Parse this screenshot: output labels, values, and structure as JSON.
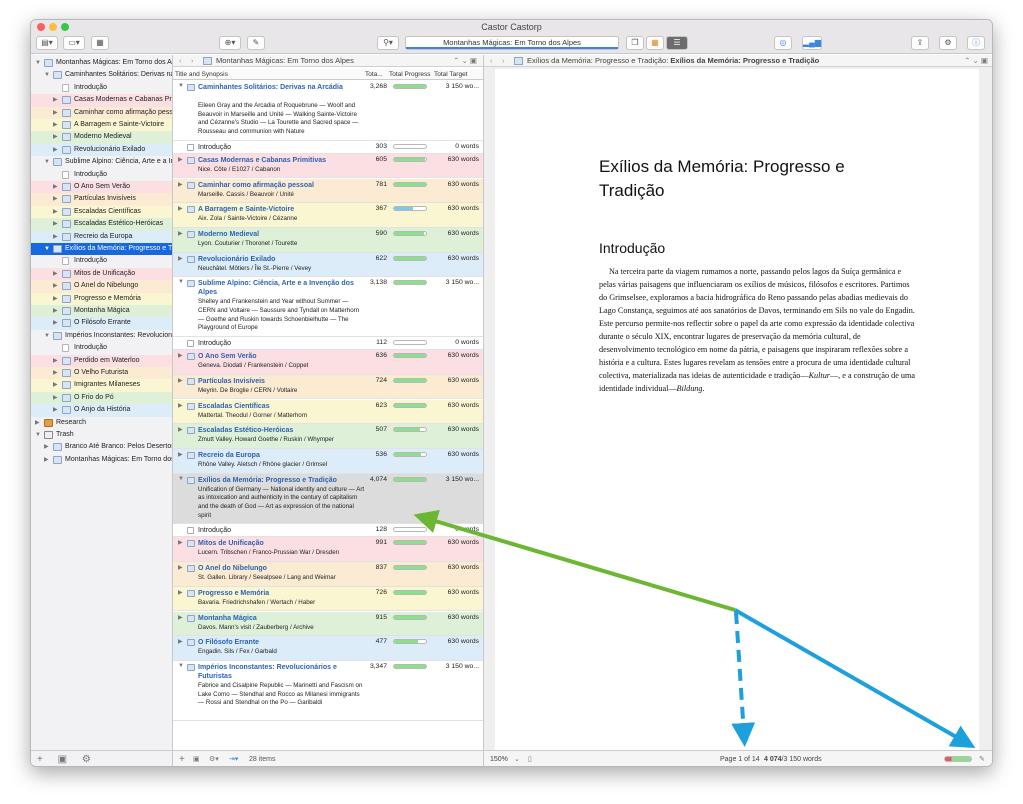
{
  "window": {
    "title": "Castor Castorp"
  },
  "toolbar": {
    "breadcrumb": "Montanhas Mágicas: Em Torno dos Alpes"
  },
  "binder": {
    "items": [
      {
        "label": "Montanhas Mágicas: Em Torno dos Alpes",
        "level": 0,
        "type": "folder",
        "tri": "▼"
      },
      {
        "label": "Caminhantes Solitários: Derivas na Arcádia",
        "level": 1,
        "type": "folder",
        "tri": "▼"
      },
      {
        "label": "Introdução",
        "level": 2,
        "type": "doc",
        "tri": ""
      },
      {
        "label": "Casas Modernas e Cabanas Primitivas",
        "level": 2,
        "type": "folder",
        "tri": "▶",
        "color": "pink"
      },
      {
        "label": "Caminhar como afirmação pessoal",
        "level": 2,
        "type": "folder",
        "tri": "▶",
        "color": "orange"
      },
      {
        "label": "A Barragem e Sainte-Victoire",
        "level": 2,
        "type": "folder",
        "tri": "▶",
        "color": "yellow"
      },
      {
        "label": "Moderno Medieval",
        "level": 2,
        "type": "folder",
        "tri": "▶",
        "color": "green"
      },
      {
        "label": "Revolucionário Exilado",
        "level": 2,
        "type": "folder",
        "tri": "▶",
        "color": "blue"
      },
      {
        "label": "Sublime Alpino: Ciência, Arte e a Invenção dos Alpes",
        "level": 1,
        "type": "folder",
        "tri": "▼"
      },
      {
        "label": "Introdução",
        "level": 2,
        "type": "doc",
        "tri": ""
      },
      {
        "label": "O Ano Sem Verão",
        "level": 2,
        "type": "folder",
        "tri": "▶",
        "color": "pink"
      },
      {
        "label": "Partículas Invisíveis",
        "level": 2,
        "type": "folder",
        "tri": "▶",
        "color": "orange"
      },
      {
        "label": "Escaladas Científicas",
        "level": 2,
        "type": "folder",
        "tri": "▶",
        "color": "yellow"
      },
      {
        "label": "Escaladas Estético-Heróicas",
        "level": 2,
        "type": "folder",
        "tri": "▶",
        "color": "green"
      },
      {
        "label": "Recreio da Europa",
        "level": 2,
        "type": "folder",
        "tri": "▶",
        "color": "blue"
      },
      {
        "label": "Exílios da Memória: Progresso e Tradição",
        "level": 1,
        "type": "folder",
        "tri": "▼",
        "selected": true
      },
      {
        "label": "Introdução",
        "level": 2,
        "type": "doc",
        "tri": ""
      },
      {
        "label": "Mitos de Unificação",
        "level": 2,
        "type": "folder",
        "tri": "▶",
        "color": "pink"
      },
      {
        "label": "O Anel do Nibelungo",
        "level": 2,
        "type": "folder",
        "tri": "▶",
        "color": "orange"
      },
      {
        "label": "Progresso e Memória",
        "level": 2,
        "type": "folder",
        "tri": "▶",
        "color": "yellow"
      },
      {
        "label": "Montanha Mágica",
        "level": 2,
        "type": "folder",
        "tri": "▶",
        "color": "green"
      },
      {
        "label": "O Filósofo Errante",
        "level": 2,
        "type": "folder",
        "tri": "▶",
        "color": "blue"
      },
      {
        "label": "Impérios Inconstantes: Revolucionários e Futuristas",
        "level": 1,
        "type": "folder",
        "tri": "▼"
      },
      {
        "label": "Introdução",
        "level": 2,
        "type": "doc",
        "tri": ""
      },
      {
        "label": "Perdido em Waterloo",
        "level": 2,
        "type": "folder",
        "tri": "▶",
        "color": "pink"
      },
      {
        "label": "O Velho Futurista",
        "level": 2,
        "type": "folder",
        "tri": "▶",
        "color": "orange"
      },
      {
        "label": "Imigrantes Milaneses",
        "level": 2,
        "type": "folder",
        "tri": "▶",
        "color": "yellow"
      },
      {
        "label": "O Frio do Pó",
        "level": 2,
        "type": "folder",
        "tri": "▶",
        "color": "green"
      },
      {
        "label": "O Anjo da História",
        "level": 2,
        "type": "folder",
        "tri": "▶",
        "color": "blue"
      },
      {
        "label": "Research",
        "level": 0,
        "type": "research",
        "tri": "▶"
      },
      {
        "label": "Trash",
        "level": 0,
        "type": "trash",
        "tri": "▼"
      },
      {
        "label": "Branco Até Branco: Pelos Desertos do Oriente",
        "level": 1,
        "type": "folder",
        "tri": "▶"
      },
      {
        "label": "Montanhas Mágicas: Em Torno dos Alpes",
        "level": 1,
        "type": "folder",
        "tri": "▶"
      }
    ]
  },
  "outliner": {
    "header": "Montanhas Mágicas: Em Torno dos Alpes",
    "columns": {
      "title": "Title and Synopsis",
      "total": "Tota...",
      "progress": "Total Progress",
      "target": "Total Target"
    },
    "rows": [
      {
        "title": "Caminhantes Solitários: Derivas na Arcádia",
        "synopsis": "Eileen Gray and the Arcadia of Roquebrune — Woolf and Beauvoir in Marseille and Unité — Walking Sainte-Victoire and Cézanne's Studio — La Tourette and Sacred space — Rousseau and communion with Nature",
        "total": "3,268",
        "progress": 1.0,
        "target": "3 150 wo...",
        "tri": "▼",
        "type": "folder"
      },
      {
        "title": "Introdução",
        "synopsis": "",
        "total": "303",
        "progress": 0,
        "target": "0 words",
        "tri": "",
        "type": "doc",
        "plain": true
      },
      {
        "title": "Casas Modernas e Cabanas Primitivas",
        "synopsis": "Nice. Côte / E1027 / Cabanon",
        "total": "605",
        "progress": 0.96,
        "target": "630 words",
        "tri": "▶",
        "type": "folder",
        "color": "pink"
      },
      {
        "title": "Caminhar como afirmação pessoal",
        "synopsis": "Marseille. Cassis / Beauvoir / Unité",
        "total": "781",
        "progress": 1.0,
        "target": "630 words",
        "tri": "▶",
        "type": "folder",
        "color": "orange"
      },
      {
        "title": "A Barragem e Sainte-Victoire",
        "synopsis": "Aix. Zola / Sainte-Victoire / Cézanne",
        "total": "367",
        "progress": 0.58,
        "target": "630 words",
        "tri": "▶",
        "type": "folder",
        "color": "yellow"
      },
      {
        "title": "Moderno Medieval",
        "synopsis": "Lyon. Couturier / Thoronet / Tourette",
        "total": "590",
        "progress": 0.94,
        "target": "630 words",
        "tri": "▶",
        "type": "folder",
        "color": "green"
      },
      {
        "title": "Revolucionário Exilado",
        "synopsis": "Neuchâtel. Môtiers / Île St.-Pierre / Vevey",
        "total": "622",
        "progress": 0.99,
        "target": "630 words",
        "tri": "▶",
        "type": "folder",
        "color": "blue"
      },
      {
        "title": "Sublime Alpino: Ciência, Arte e a Invenção dos Alpes",
        "synopsis": "Shelley and Frankenstein and Year without Summer — CERN and Voltaire — Saussure and Tyndall on Matterhorn — Goethe and Ruskin towards Schoenbielhutte — The Playground of Europe",
        "total": "3,138",
        "progress": 1.0,
        "target": "3 150 wo...",
        "tri": "▼",
        "type": "folder"
      },
      {
        "title": "Introdução",
        "synopsis": "",
        "total": "112",
        "progress": 0,
        "target": "0 words",
        "tri": "",
        "type": "doc",
        "plain": true
      },
      {
        "title": "O Ano Sem Verão",
        "synopsis": "Geneva. Diodati / Frankenstein / Coppet",
        "total": "636",
        "progress": 1.0,
        "target": "630 words",
        "tri": "▶",
        "type": "folder",
        "color": "pink"
      },
      {
        "title": "Partículas Invisíveis",
        "synopsis": "Meyrin. De Broglie / CERN / Voltaire",
        "total": "724",
        "progress": 1.0,
        "target": "630 words",
        "tri": "▶",
        "type": "folder",
        "color": "orange"
      },
      {
        "title": "Escaladas Científicas",
        "synopsis": "Mattertal. Theodul / Gorner / Matterhorn",
        "total": "623",
        "progress": 0.99,
        "target": "630 words",
        "tri": "▶",
        "type": "folder",
        "color": "yellow"
      },
      {
        "title": "Escaladas Estético-Heróicas",
        "synopsis": "Zmutt Valley. Howard Goethe / Ruskin / Whymper",
        "total": "507",
        "progress": 0.8,
        "target": "630 words",
        "tri": "▶",
        "type": "folder",
        "color": "green"
      },
      {
        "title": "Recreio da Europa",
        "synopsis": "Rhône Valley. Aletsch / Rhône glacier / Grimsel",
        "total": "536",
        "progress": 0.85,
        "target": "630 words",
        "tri": "▶",
        "type": "folder",
        "color": "blue"
      },
      {
        "title": "Exílios da Memória: Progresso e Tradição",
        "synopsis": "Unification of Germany — National identity and culture — Art as intoxication and authenticity in the century of capitalism and the death of God — Art as expression of the national spirit",
        "total": "4,074",
        "progress": 1.0,
        "target": "3 150 wo...",
        "tri": "▼",
        "type": "folder",
        "selected": true
      },
      {
        "title": "Introdução",
        "synopsis": "",
        "total": "128",
        "progress": 0,
        "target": "0 words",
        "tri": "",
        "type": "doc",
        "plain": true
      },
      {
        "title": "Mitos de Unificação",
        "synopsis": "Lucern. Tribschen / Franco-Prussian War / Dresden",
        "total": "991",
        "progress": 1.0,
        "target": "630 words",
        "tri": "▶",
        "type": "folder",
        "color": "pink"
      },
      {
        "title": "O Anel do Nibelungo",
        "synopsis": "St. Gallen. Library / Seealpsee / Lang and Weimar",
        "total": "837",
        "progress": 1.0,
        "target": "630 words",
        "tri": "▶",
        "type": "folder",
        "color": "orange"
      },
      {
        "title": "Progresso e Memória",
        "synopsis": "Bavaria. Friedrichshafen / Wertach / Haber",
        "total": "726",
        "progress": 1.0,
        "target": "630 words",
        "tri": "▶",
        "type": "folder",
        "color": "yellow"
      },
      {
        "title": "Montanha Mágica",
        "synopsis": "Davos. Mann's visit / Zauberberg / Archive",
        "total": "915",
        "progress": 1.0,
        "target": "630 words",
        "tri": "▶",
        "type": "folder",
        "color": "green"
      },
      {
        "title": "O Filósofo Errante",
        "synopsis": "Engadin. Sils / Fex / Garbald",
        "total": "477",
        "progress": 0.76,
        "target": "630 words",
        "tri": "▶",
        "type": "folder",
        "color": "blue"
      },
      {
        "title": "Impérios Inconstantes: Revolucionários e Futuristas",
        "synopsis": "Fabrice and Cisalpine Republic — Marinetti and Fascism on Lake Como — Stendhal and Rocco as Milanesi immigrants — Rossi and Stendhal on the Po — Garibaldi",
        "total": "3,347",
        "progress": 1.0,
        "target": "3 150 wo...",
        "tri": "▼",
        "type": "folder"
      }
    ],
    "footer": {
      "count": "28 items"
    }
  },
  "editor": {
    "header": "Exílios da Memória: Progresso e Tradição",
    "header_prefix": "Exílios da Memória: Progresso e Tradição:",
    "doc_title": "Exílios da Memória: Progresso e Tradição",
    "heading": "Introdução",
    "body": "Na terceira parte da viagem rumamos a norte, passando pelos lagos da Suíça germânica e pelas várias paisagens que influenciaram os exílios de músicos, filósofos e escritores. Partimos do Grimselsee, exploramos a bacia hidrográfica do Reno passando pelas abadias medievais do Lago Constança, seguimos até aos sanatórios de Davos, terminando em Sils no vale do Engadin. Este percurso permite-nos reflectir sobre o papel da arte como expressão da identidade colectiva durante o século XIX, encontrar lugares de preservação da memória cultural, de desenvolvimento tecnológico em nome da pátria, e paisagens que inspiraram reflexões sobre a história e a cultura. Estes lugares revelam as tensões entre a procura de uma identidade cultural colectiva, materializada nas ideias de autenticidade e tradição—",
    "body_em1": "Kultur",
    "body_mid": "—, e a construção de uma identidade individual—",
    "body_em2": "Bildung",
    "body_end": ".",
    "footer": {
      "zoom": "150%",
      "page": "Page 1 of 14",
      "words": "4 074",
      "words_suffix": "/3 150 words"
    }
  },
  "colors": {
    "selection": "#1667e0",
    "progress": "#8be08c",
    "arrow_green": "#6bb733",
    "arrow_blue": "#1ea0dc"
  }
}
